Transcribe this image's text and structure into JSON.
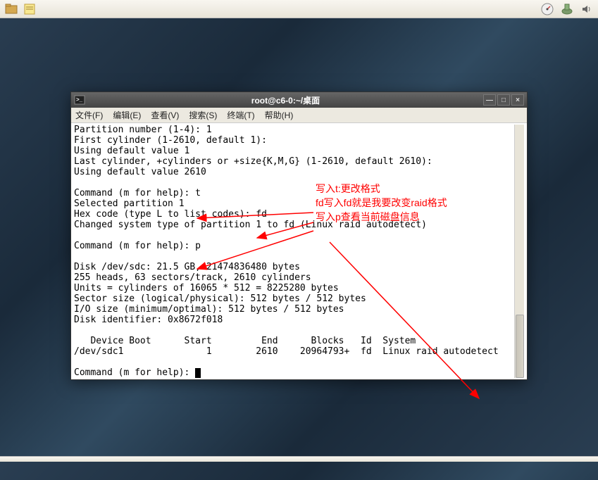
{
  "panel": {
    "icons": {
      "monitor": "system-monitor-icon",
      "update": "update-icon",
      "volume": "volume-icon"
    }
  },
  "window": {
    "title": "root@c6-0:~/桌面"
  },
  "menubar": {
    "file": "文件(F)",
    "edit": "编辑(E)",
    "view": "查看(V)",
    "search": "搜索(S)",
    "terminal": "终端(T)",
    "help": "帮助(H)"
  },
  "terminal": {
    "lines": [
      "Partition number (1-4): 1",
      "First cylinder (1-2610, default 1):",
      "Using default value 1",
      "Last cylinder, +cylinders or +size{K,M,G} (1-2610, default 2610):",
      "Using default value 2610",
      "",
      "Command (m for help): t",
      "Selected partition 1",
      "Hex code (type L to list codes): fd",
      "Changed system type of partition 1 to fd (Linux raid autodetect)",
      "",
      "Command (m for help): p",
      "",
      "Disk /dev/sdc: 21.5 GB, 21474836480 bytes",
      "255 heads, 63 sectors/track, 2610 cylinders",
      "Units = cylinders of 16065 * 512 = 8225280 bytes",
      "Sector size (logical/physical): 512 bytes / 512 bytes",
      "I/O size (minimum/optimal): 512 bytes / 512 bytes",
      "Disk identifier: 0x8672f018",
      "",
      "   Device Boot      Start         End      Blocks   Id  System",
      "/dev/sdc1               1        2610    20964793+  fd  Linux raid autodetect",
      "",
      "Command (m for help): "
    ]
  },
  "annotations": {
    "line1": "写入t:更改格式",
    "line2": "fd写入fd就是我要改变raid格式",
    "line3": "写入p查看当前磁盘信息"
  }
}
